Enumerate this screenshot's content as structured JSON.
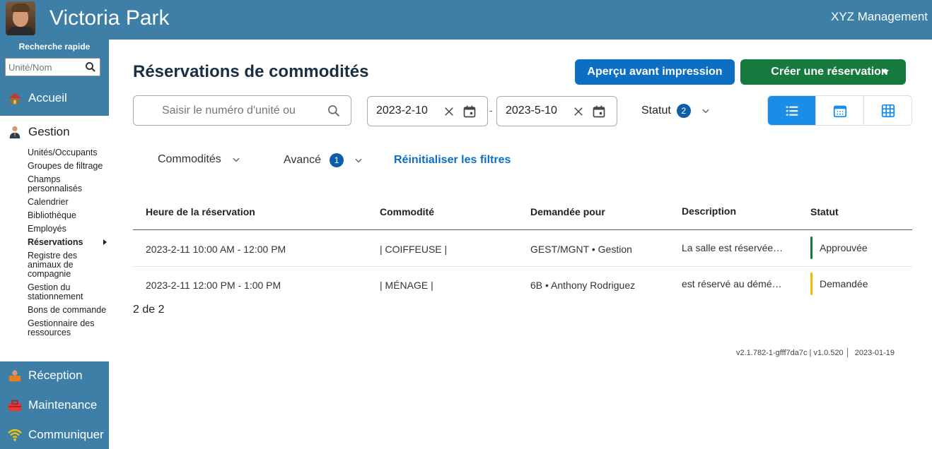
{
  "header": {
    "title": "Victoria Park",
    "company": "XYZ Management"
  },
  "sidebar": {
    "quick_search_label": "Recherche rapide",
    "quick_search_placeholder": "Unité/Nom",
    "home_label": "Accueil",
    "gestion_label": "Gestion",
    "gestion_items": [
      {
        "label": "Unités/Occupants"
      },
      {
        "label": "Groupes de filtrage"
      },
      {
        "label": "Champs personnalisés"
      },
      {
        "label": "Calendrier"
      },
      {
        "label": "Bibliothèque"
      },
      {
        "label": "Employés"
      },
      {
        "label": "Réservations"
      },
      {
        "label": "Registre des animaux de compagnie"
      },
      {
        "label": "Gestion du stationnement"
      },
      {
        "label": "Bons de commande"
      },
      {
        "label": "Gestionnaire des ressources"
      }
    ],
    "reception_label": "Réception",
    "maintenance_label": "Maintenance",
    "communiquer_label": "Communiquer"
  },
  "main": {
    "page_title": "Réservations de commodités",
    "print_preview_label": "Aperçu avant impression",
    "create_label": "Créer une réservation",
    "search_placeholder": "Saisir le numéro d'unité ou",
    "date_from": "2023-2-10",
    "date_separator": "-",
    "date_to": "2023-5-10",
    "status_filter_label": "Statut",
    "status_filter_count": "2",
    "amenities_filter_label": "Commodités",
    "advanced_filter_label": "Avancé",
    "advanced_filter_count": "1",
    "reset_filters_label": "Réinitialiser les filtres",
    "table": {
      "headers": [
        "Heure de la réservation",
        "Commodité",
        "Demandée pour",
        "Description",
        "Statut"
      ],
      "rows": [
        {
          "time": "2023-2-11 10:00 AM - 12:00 PM",
          "amenity": "| COIFFEUSE |",
          "requested_for": "GEST/MGNT • Gestion",
          "description": "La salle est réservée…",
          "status": "Approuvée",
          "status_color": "#167a3e"
        },
        {
          "time": "2023-2-11 12:00 PM - 1:00 PM",
          "amenity": "| MÉNAGE |",
          "requested_for": "6B • Anthony Rodriguez",
          "description": "est réservé au démé…",
          "status": "Demandée",
          "status_color": "#f5b800"
        }
      ]
    },
    "record_count": "2 de 2",
    "version_info": "v2.1.782-1-gfff7da7c | v1.0.520 │  2023-01-19"
  },
  "colors": {
    "header_bg": "#3d7fa6",
    "primary_button": "#0d6fc4",
    "create_button": "#167a3e",
    "active_view": "#1a8de8"
  }
}
